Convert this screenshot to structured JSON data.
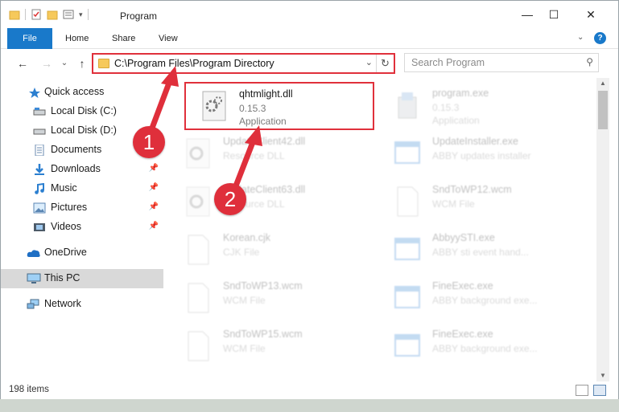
{
  "window": {
    "title": "Program",
    "controls": {
      "minimize": "—",
      "maximize": "☐",
      "close": "✕"
    }
  },
  "ribbon": {
    "tabs": [
      {
        "label": "File"
      },
      {
        "label": "Home"
      },
      {
        "label": "Share"
      },
      {
        "label": "View"
      }
    ],
    "accent_color": "#1979ca"
  },
  "navigation": {
    "back_icon": "←",
    "forward_icon": "→",
    "recent_icon": "⌄",
    "up_icon": "↑",
    "address_path": "C:\\Program Files\\Program Directory",
    "address_dropdown_icon": "⌄",
    "refresh_icon": "↻",
    "search_placeholder": "Search Program",
    "search_icon": "⚲"
  },
  "sidebar": {
    "items": [
      {
        "label": "Quick access",
        "icon": "star-icon",
        "pinned": false
      },
      {
        "label": "Local Disk (C:)",
        "icon": "drive-icon",
        "pinned": false
      },
      {
        "label": "Local Disk (D:)",
        "icon": "drive-icon",
        "pinned": false
      },
      {
        "label": "Documents",
        "icon": "documents-icon",
        "pinned": false
      },
      {
        "label": "Downloads",
        "icon": "download-icon",
        "pinned": true
      },
      {
        "label": "Music",
        "icon": "music-icon",
        "pinned": true
      },
      {
        "label": "Pictures",
        "icon": "pictures-icon",
        "pinned": true
      },
      {
        "label": "Videos",
        "icon": "videos-icon",
        "pinned": true
      },
      {
        "label": "OneDrive",
        "icon": "cloud-icon",
        "pinned": false
      },
      {
        "label": "This PC",
        "icon": "computer-icon",
        "pinned": false,
        "selected": true
      },
      {
        "label": "Network",
        "icon": "network-icon",
        "pinned": false
      }
    ],
    "pin_glyph": "📌"
  },
  "files": [
    {
      "name": "qhtmlight.dll",
      "line1": "0.15.3",
      "line2": "Application",
      "icon": "dll-gear-icon",
      "highlighted": true
    },
    {
      "name": "program.exe",
      "line1": "0.15.3",
      "line2": "Application",
      "icon": "installer-icon"
    },
    {
      "name": "UpdateClient42.dll",
      "line1": "Resource DLL",
      "line2": "",
      "icon": "dll-gear-icon"
    },
    {
      "name": "UpdateInstaller.exe",
      "line1": "ABBY updates installer",
      "line2": "",
      "icon": "window-app-icon"
    },
    {
      "name": "UpdateClient63.dll",
      "line1": "Resource DLL",
      "line2": "",
      "icon": "dll-gear-icon"
    },
    {
      "name": "SndToWP12.wcm",
      "line1": "WCM File",
      "line2": "",
      "icon": "blank-file-icon"
    },
    {
      "name": "Korean.cjk",
      "line1": "CJK File",
      "line2": "",
      "icon": "blank-file-icon"
    },
    {
      "name": "AbbyySTI.exe",
      "line1": "ABBY sti event hand...",
      "line2": "",
      "icon": "window-app-icon"
    },
    {
      "name": "SndToWP13.wcm",
      "line1": "WCM File",
      "line2": "",
      "icon": "blank-file-icon"
    },
    {
      "name": "FineExec.exe",
      "line1": "ABBY background exe...",
      "line2": "",
      "icon": "window-app-icon"
    },
    {
      "name": "SndToWP15.wcm",
      "line1": "WCM File",
      "line2": "",
      "icon": "blank-file-icon"
    },
    {
      "name": "FineExec.exe",
      "line1": "ABBY background exe...",
      "line2": "",
      "icon": "window-app-icon"
    }
  ],
  "status": {
    "item_count": "198 items"
  },
  "annotations": {
    "badge1": "1",
    "badge2": "2",
    "color": "#df2f3b"
  }
}
